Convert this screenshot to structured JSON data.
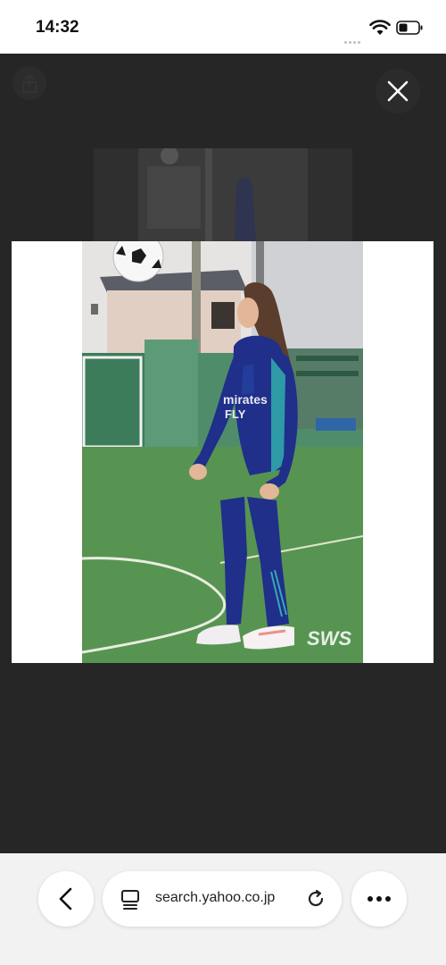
{
  "status_bar": {
    "time": "14:32"
  },
  "viewer": {
    "close_icon": "close-icon",
    "image_watermark": "SWS",
    "jersey_text_line1": "mirates",
    "jersey_text_line2": "FLY"
  },
  "browser_bar": {
    "url": "search.yahoo.co.jp",
    "back_icon": "chevron-left-icon",
    "tabs_icon": "tabs-icon",
    "reload_icon": "reload-icon",
    "more_icon": "more-icon"
  }
}
